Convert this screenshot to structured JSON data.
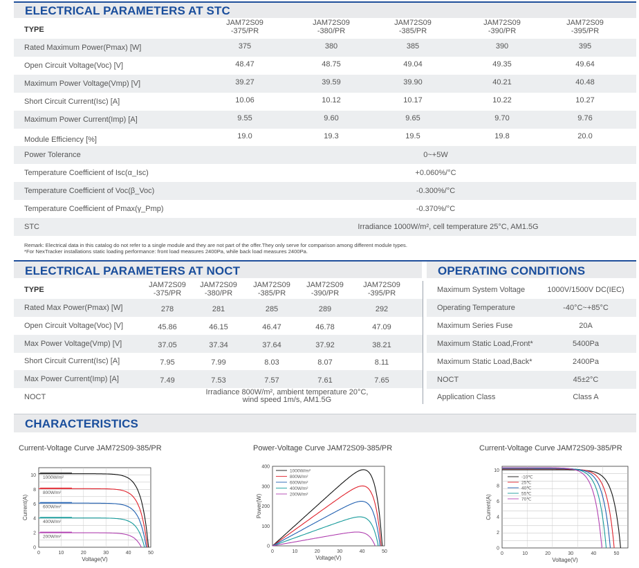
{
  "stc": {
    "title": "ELECTRICAL PARAMETERS AT STC",
    "type_label": "TYPE",
    "models": [
      "JAM72S09\n-375/PR",
      "JAM72S09\n-380/PR",
      "JAM72S09\n-385/PR",
      "JAM72S09\n-390/PR",
      "JAM72S09\n-395/PR"
    ],
    "rows": [
      {
        "label": "Rated Maximum Power(Pmax) [W]",
        "values": [
          "375",
          "380",
          "385",
          "390",
          "395"
        ]
      },
      {
        "label": "Open Circuit Voltage(Voc) [V]",
        "values": [
          "48.47",
          "48.75",
          "49.04",
          "49.35",
          "49.64"
        ]
      },
      {
        "label": "Maximum Power Voltage(Vmp) [V]",
        "values": [
          "39.27",
          "39.59",
          "39.90",
          "40.21",
          "40.48"
        ]
      },
      {
        "label": "Short Circuit Current(Isc) [A]",
        "values": [
          "10.06",
          "10.12",
          "10.17",
          "10.22",
          "10.27"
        ]
      },
      {
        "label": "Maximum Power Current(Imp) [A]",
        "values": [
          "9.55",
          "9.60",
          "9.65",
          "9.70",
          "9.76"
        ]
      },
      {
        "label": "Module Efficiency [%]",
        "values": [
          "19.0",
          "19.3",
          "19.5",
          "19.8",
          "20.0"
        ]
      },
      {
        "label": "Power Tolerance",
        "value": "0~+5W"
      },
      {
        "label": "Temperature Coefficient of Isc(α_Isc)",
        "value": "+0.060%/°C"
      },
      {
        "label": "Temperature Coefficient of Voc(β_Voc)",
        "value": "-0.300%/°C"
      },
      {
        "label": "Temperature Coefficient of Pmax(γ_Pmp)",
        "value": "-0.370%/°C"
      },
      {
        "label": "STC",
        "value": "Irradiance 1000W/m²,  cell temperature 25°C, AM1.5G"
      }
    ],
    "remark1": "Remark: Electrical data in this catalog do not refer to a single module and they are not part of the offer.They only serve for comparison among different module types.",
    "remark2": "*For NexTracker installations static loading performance: front load measures 2400Pa, while back load measures 2400Pa."
  },
  "noct": {
    "title": "ELECTRICAL PARAMETERS AT NOCT",
    "type_label": "TYPE",
    "models": [
      "JAM72S09\n-375/PR",
      "JAM72S09\n-380/PR",
      "JAM72S09\n-385/PR",
      "JAM72S09\n-390/PR",
      "JAM72S09\n-395/PR"
    ],
    "rows": [
      {
        "label": "Rated Max Power(Pmax) [W]",
        "values": [
          "278",
          "281",
          "285",
          "289",
          "292"
        ]
      },
      {
        "label": "Open Circuit Voltage(Voc) [V]",
        "values": [
          "45.86",
          "46.15",
          "46.47",
          "46.78",
          "47.09"
        ]
      },
      {
        "label": "Max Power Voltage(Vmp) [V]",
        "values": [
          "37.05",
          "37.34",
          "37.64",
          "37.92",
          "38.21"
        ]
      },
      {
        "label": "Short Circuit Current(Isc) [A]",
        "values": [
          "7.95",
          "7.99",
          "8.03",
          "8.07",
          "8.11"
        ]
      },
      {
        "label": "Max Power Current(Imp) [A]",
        "values": [
          "7.49",
          "7.53",
          "7.57",
          "7.61",
          "7.65"
        ]
      },
      {
        "label": "NOCT",
        "value": "Irradiance 800W/m², ambient temperature 20°C,\nwind speed 1m/s, AM1.5G"
      }
    ]
  },
  "operating": {
    "title": "OPERATING CONDITIONS",
    "rows": [
      {
        "label": "Maximum System Voltage",
        "value": "1000V/1500V DC(IEC)"
      },
      {
        "label": "Operating Temperature",
        "value": "-40°C~+85°C"
      },
      {
        "label": "Maximum Series Fuse",
        "value": "20A"
      },
      {
        "label": "Maximum Static Load,Front*",
        "value": "5400Pa"
      },
      {
        "label": "Maximum Static Load,Back*",
        "value": "2400Pa"
      },
      {
        "label": "NOCT",
        "value": "45±2°C"
      },
      {
        "label": "Application Class",
        "value": "Class A"
      }
    ]
  },
  "characteristics": {
    "title": "CHARACTERISTICS",
    "chart_titles": [
      "Current-Voltage Curve   JAM72S09-385/PR",
      "Power-Voltage Curve   JAM72S09-385/PR",
      "Current-Voltage Curve   JAM72S09-385/PR"
    ]
  },
  "chart_data": [
    {
      "type": "line",
      "title": "Current-Voltage Curve   JAM72S09-385/PR",
      "xlabel": "Voltage(V)",
      "ylabel": "Current(A)",
      "xlim": [
        0,
        50
      ],
      "ylim": [
        0,
        11
      ],
      "xticks": [
        0,
        10,
        20,
        30,
        40,
        50
      ],
      "yticks": [
        0,
        2,
        4,
        6,
        8,
        10
      ],
      "grid": true,
      "series": [
        {
          "name": "1000W/m²",
          "color": "#111111",
          "isc": 10.17,
          "voc": 49.0
        },
        {
          "name": "800W/m²",
          "color": "#e0202a",
          "isc": 8.1,
          "voc": 48.5
        },
        {
          "name": "600W/m²",
          "color": "#1f5fb0",
          "isc": 6.1,
          "voc": 48.0
        },
        {
          "name": "400W/m²",
          "color": "#159a9a",
          "isc": 4.05,
          "voc": 47.2
        },
        {
          "name": "200W/m²",
          "color": "#b040b0",
          "isc": 2.0,
          "voc": 45.8
        }
      ]
    },
    {
      "type": "line",
      "title": "Power-Voltage Curve   JAM72S09-385/PR",
      "xlabel": "Voltage(V)",
      "ylabel": "Power(W)",
      "xlim": [
        0,
        50
      ],
      "ylim": [
        0,
        400
      ],
      "xticks": [
        0,
        10,
        20,
        30,
        40,
        50
      ],
      "yticks": [
        0,
        100,
        200,
        300,
        400
      ],
      "grid": false,
      "series": [
        {
          "name": "1000W/m²",
          "color": "#111111",
          "isc": 10.17,
          "voc": 49.0
        },
        {
          "name": "800W/m²",
          "color": "#e0202a",
          "isc": 8.1,
          "voc": 48.5
        },
        {
          "name": "600W/m²",
          "color": "#1f5fb0",
          "isc": 6.1,
          "voc": 48.0
        },
        {
          "name": "400W/m²",
          "color": "#159a9a",
          "isc": 4.05,
          "voc": 47.2
        },
        {
          "name": "200W/m²",
          "color": "#b040b0",
          "isc": 2.0,
          "voc": 45.8
        }
      ]
    },
    {
      "type": "line",
      "title": "Current-Voltage Curve   JAM72S09-385/PR",
      "xlabel": "Voltage(V)",
      "ylabel": "Current(A)",
      "xlim": [
        0,
        55
      ],
      "ylim": [
        0,
        10.5
      ],
      "xticks": [
        0,
        10,
        20,
        30,
        40,
        50
      ],
      "yticks": [
        0,
        2,
        4,
        6,
        8,
        10
      ],
      "grid": true,
      "series": [
        {
          "name": "-10℃",
          "color": "#111111",
          "isc": 10.05,
          "voc": 51.8
        },
        {
          "name": "25℃",
          "color": "#e0202a",
          "isc": 10.17,
          "voc": 49.0
        },
        {
          "name": "40℃",
          "color": "#1f5fb0",
          "isc": 10.22,
          "voc": 47.3
        },
        {
          "name": "55℃",
          "color": "#159a9a",
          "isc": 10.27,
          "voc": 45.5
        },
        {
          "name": "70℃",
          "color": "#b040b0",
          "isc": 10.32,
          "voc": 43.6
        }
      ]
    }
  ]
}
